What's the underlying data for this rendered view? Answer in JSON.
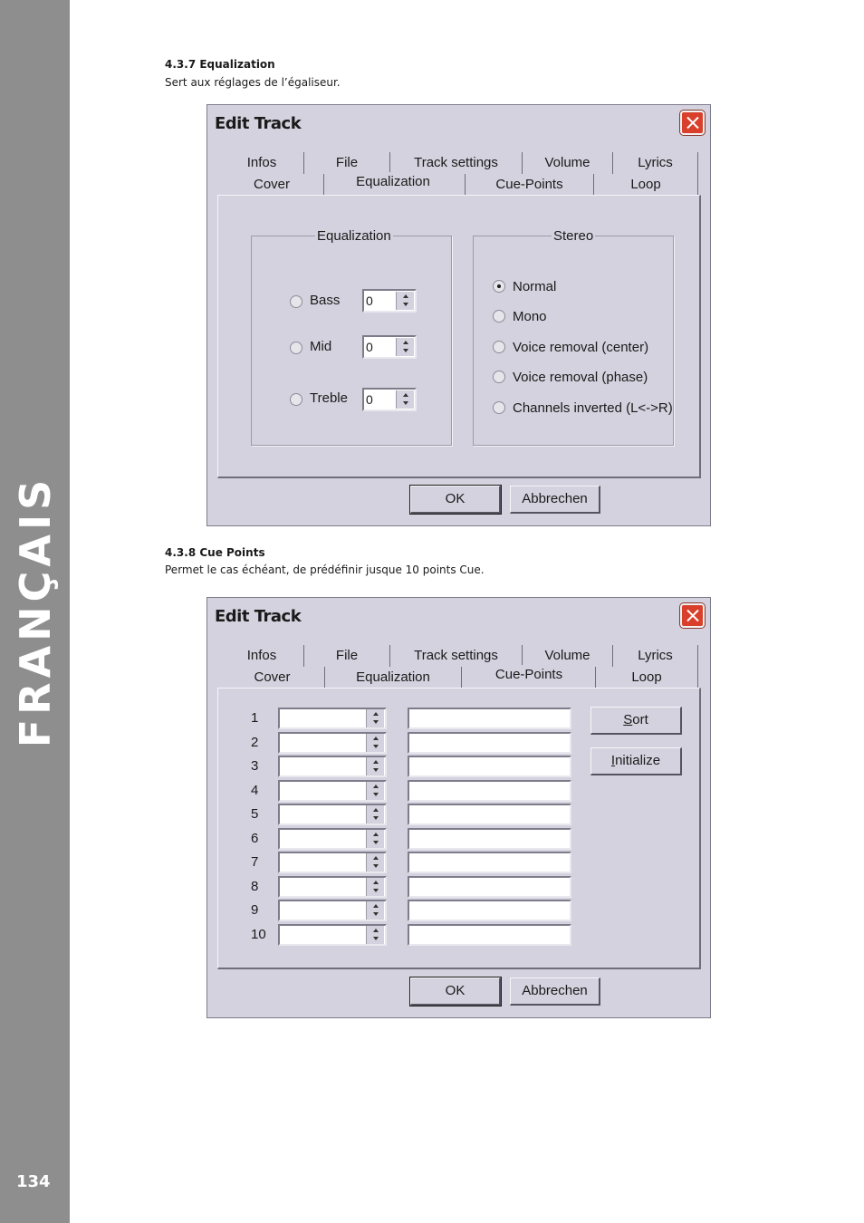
{
  "sidebar": {
    "language": "FRANÇAIS",
    "page_number": "134"
  },
  "section1": {
    "heading": "4.3.7 Equalization",
    "description": "Sert aux réglages de l’égaliseur."
  },
  "section2": {
    "heading": "4.3.8 Cue Points",
    "description": "Permet le cas échéant, de prédéfinir jusque 10 points Cue."
  },
  "dialog": {
    "title": "Edit Track",
    "tabs_row1": [
      "Infos",
      "File",
      "Track settings",
      "Volume",
      "Lyrics"
    ],
    "tabs_row2": [
      "Cover",
      "Equalization",
      "Cue-Points",
      "Loop"
    ],
    "ok_label": "OK",
    "cancel_label": "Abbrechen"
  },
  "equalization_panel": {
    "active_tab": "Equalization",
    "eq_group_label": "Equalization",
    "eq_rows": [
      {
        "label": "Bass",
        "value": "0"
      },
      {
        "label": "Mid",
        "value": "0"
      },
      {
        "label": "Treble",
        "value": "0"
      }
    ],
    "stereo_group_label": "Stereo",
    "stereo_options": [
      {
        "label": "Normal",
        "checked": true
      },
      {
        "label": "Mono",
        "checked": false
      },
      {
        "label": "Voice removal (center)",
        "checked": false
      },
      {
        "label": "Voice removal (phase)",
        "checked": false
      },
      {
        "label": "Channels inverted (L<->R)",
        "checked": false
      }
    ]
  },
  "cue_panel": {
    "active_tab": "Cue-Points",
    "rows": [
      "1",
      "2",
      "3",
      "4",
      "5",
      "6",
      "7",
      "8",
      "9",
      "10"
    ],
    "sort_label_underlined": "S",
    "sort_label_rest": "ort",
    "initialize_label_underlined": "I",
    "initialize_label_rest": "nitialize"
  }
}
